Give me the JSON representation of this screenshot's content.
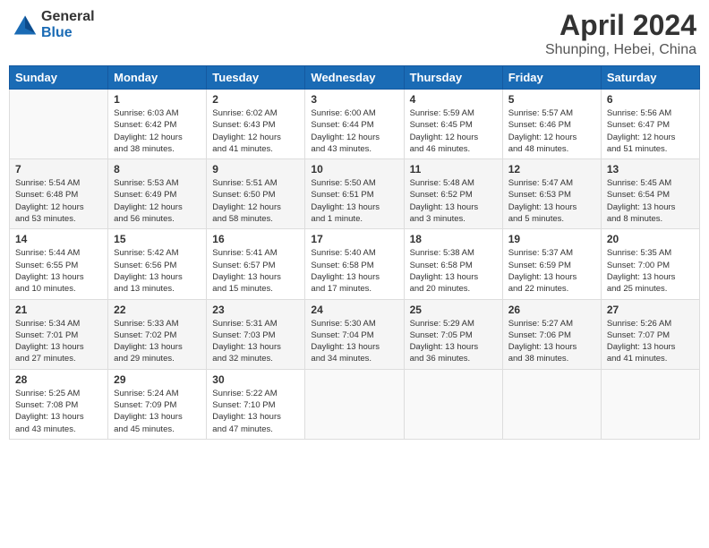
{
  "header": {
    "logo_general": "General",
    "logo_blue": "Blue",
    "title": "April 2024",
    "subtitle": "Shunping, Hebei, China"
  },
  "days_of_week": [
    "Sunday",
    "Monday",
    "Tuesday",
    "Wednesday",
    "Thursday",
    "Friday",
    "Saturday"
  ],
  "weeks": [
    [
      {
        "day": "",
        "info": ""
      },
      {
        "day": "1",
        "info": "Sunrise: 6:03 AM\nSunset: 6:42 PM\nDaylight: 12 hours\nand 38 minutes."
      },
      {
        "day": "2",
        "info": "Sunrise: 6:02 AM\nSunset: 6:43 PM\nDaylight: 12 hours\nand 41 minutes."
      },
      {
        "day": "3",
        "info": "Sunrise: 6:00 AM\nSunset: 6:44 PM\nDaylight: 12 hours\nand 43 minutes."
      },
      {
        "day": "4",
        "info": "Sunrise: 5:59 AM\nSunset: 6:45 PM\nDaylight: 12 hours\nand 46 minutes."
      },
      {
        "day": "5",
        "info": "Sunrise: 5:57 AM\nSunset: 6:46 PM\nDaylight: 12 hours\nand 48 minutes."
      },
      {
        "day": "6",
        "info": "Sunrise: 5:56 AM\nSunset: 6:47 PM\nDaylight: 12 hours\nand 51 minutes."
      }
    ],
    [
      {
        "day": "7",
        "info": "Sunrise: 5:54 AM\nSunset: 6:48 PM\nDaylight: 12 hours\nand 53 minutes."
      },
      {
        "day": "8",
        "info": "Sunrise: 5:53 AM\nSunset: 6:49 PM\nDaylight: 12 hours\nand 56 minutes."
      },
      {
        "day": "9",
        "info": "Sunrise: 5:51 AM\nSunset: 6:50 PM\nDaylight: 12 hours\nand 58 minutes."
      },
      {
        "day": "10",
        "info": "Sunrise: 5:50 AM\nSunset: 6:51 PM\nDaylight: 13 hours\nand 1 minute."
      },
      {
        "day": "11",
        "info": "Sunrise: 5:48 AM\nSunset: 6:52 PM\nDaylight: 13 hours\nand 3 minutes."
      },
      {
        "day": "12",
        "info": "Sunrise: 5:47 AM\nSunset: 6:53 PM\nDaylight: 13 hours\nand 5 minutes."
      },
      {
        "day": "13",
        "info": "Sunrise: 5:45 AM\nSunset: 6:54 PM\nDaylight: 13 hours\nand 8 minutes."
      }
    ],
    [
      {
        "day": "14",
        "info": "Sunrise: 5:44 AM\nSunset: 6:55 PM\nDaylight: 13 hours\nand 10 minutes."
      },
      {
        "day": "15",
        "info": "Sunrise: 5:42 AM\nSunset: 6:56 PM\nDaylight: 13 hours\nand 13 minutes."
      },
      {
        "day": "16",
        "info": "Sunrise: 5:41 AM\nSunset: 6:57 PM\nDaylight: 13 hours\nand 15 minutes."
      },
      {
        "day": "17",
        "info": "Sunrise: 5:40 AM\nSunset: 6:58 PM\nDaylight: 13 hours\nand 17 minutes."
      },
      {
        "day": "18",
        "info": "Sunrise: 5:38 AM\nSunset: 6:58 PM\nDaylight: 13 hours\nand 20 minutes."
      },
      {
        "day": "19",
        "info": "Sunrise: 5:37 AM\nSunset: 6:59 PM\nDaylight: 13 hours\nand 22 minutes."
      },
      {
        "day": "20",
        "info": "Sunrise: 5:35 AM\nSunset: 7:00 PM\nDaylight: 13 hours\nand 25 minutes."
      }
    ],
    [
      {
        "day": "21",
        "info": "Sunrise: 5:34 AM\nSunset: 7:01 PM\nDaylight: 13 hours\nand 27 minutes."
      },
      {
        "day": "22",
        "info": "Sunrise: 5:33 AM\nSunset: 7:02 PM\nDaylight: 13 hours\nand 29 minutes."
      },
      {
        "day": "23",
        "info": "Sunrise: 5:31 AM\nSunset: 7:03 PM\nDaylight: 13 hours\nand 32 minutes."
      },
      {
        "day": "24",
        "info": "Sunrise: 5:30 AM\nSunset: 7:04 PM\nDaylight: 13 hours\nand 34 minutes."
      },
      {
        "day": "25",
        "info": "Sunrise: 5:29 AM\nSunset: 7:05 PM\nDaylight: 13 hours\nand 36 minutes."
      },
      {
        "day": "26",
        "info": "Sunrise: 5:27 AM\nSunset: 7:06 PM\nDaylight: 13 hours\nand 38 minutes."
      },
      {
        "day": "27",
        "info": "Sunrise: 5:26 AM\nSunset: 7:07 PM\nDaylight: 13 hours\nand 41 minutes."
      }
    ],
    [
      {
        "day": "28",
        "info": "Sunrise: 5:25 AM\nSunset: 7:08 PM\nDaylight: 13 hours\nand 43 minutes."
      },
      {
        "day": "29",
        "info": "Sunrise: 5:24 AM\nSunset: 7:09 PM\nDaylight: 13 hours\nand 45 minutes."
      },
      {
        "day": "30",
        "info": "Sunrise: 5:22 AM\nSunset: 7:10 PM\nDaylight: 13 hours\nand 47 minutes."
      },
      {
        "day": "",
        "info": ""
      },
      {
        "day": "",
        "info": ""
      },
      {
        "day": "",
        "info": ""
      },
      {
        "day": "",
        "info": ""
      }
    ]
  ]
}
